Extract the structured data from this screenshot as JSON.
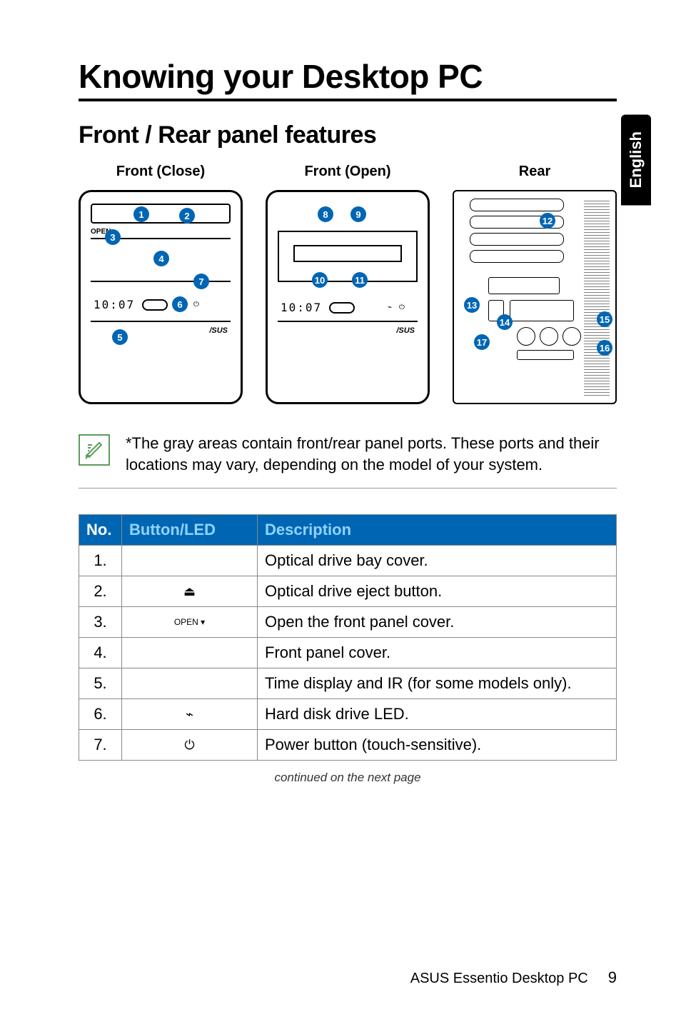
{
  "side_tab": "English",
  "title": "Knowing your Desktop PC",
  "subtitle": "Front / Rear panel features",
  "diagram_labels": {
    "front_close": "Front (Close)",
    "front_open": "Front (Open)",
    "rear": "Rear"
  },
  "diagram_text": {
    "time": "10:07",
    "logo": "/SUS",
    "open": "OPEN"
  },
  "callouts": {
    "front_close": [
      "1",
      "2",
      "3",
      "4",
      "5",
      "6",
      "7"
    ],
    "front_open": [
      "8",
      "9",
      "10",
      "11"
    ],
    "rear": [
      "12",
      "13",
      "14",
      "15",
      "16",
      "17"
    ]
  },
  "note": "*The gray areas contain front/rear panel ports. These ports and their locations may vary, depending on the model of your system.",
  "table": {
    "headers": {
      "no": "No.",
      "button": "Button/LED",
      "description": "Description"
    },
    "rows": [
      {
        "no": "1.",
        "button": "",
        "description": "Optical drive bay cover."
      },
      {
        "no": "2.",
        "button": "⏏",
        "description": "Optical drive eject button."
      },
      {
        "no": "3.",
        "button": "OPEN ▾",
        "description": "Open the front panel cover."
      },
      {
        "no": "4.",
        "button": "",
        "description": "Front panel cover."
      },
      {
        "no": "5.",
        "button": "",
        "description": "Time display and IR (for some models only)."
      },
      {
        "no": "6.",
        "button": "⌁",
        "description": "Hard disk drive LED."
      },
      {
        "no": "7.",
        "button": "⏻",
        "description": "Power button (touch-sensitive)."
      }
    ]
  },
  "continued": "continued on the next page",
  "footer": {
    "product": "ASUS Essentio Desktop PC",
    "page": "9"
  }
}
